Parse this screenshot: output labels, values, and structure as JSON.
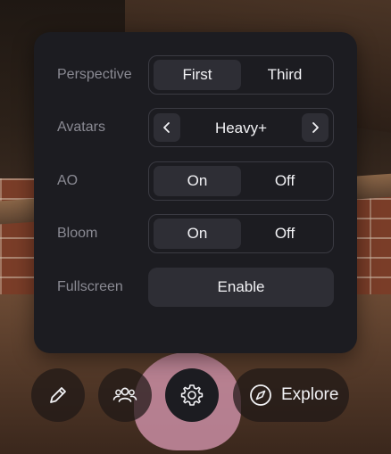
{
  "settings": {
    "perspective": {
      "label": "Perspective",
      "options": [
        "First",
        "Third"
      ],
      "selected": "First"
    },
    "avatars": {
      "label": "Avatars",
      "value": "Heavy+",
      "prev_icon": "chevron-left-icon",
      "next_icon": "chevron-right-icon"
    },
    "ao": {
      "label": "AO",
      "options": [
        "On",
        "Off"
      ],
      "selected": "On"
    },
    "bloom": {
      "label": "Bloom",
      "options": [
        "On",
        "Off"
      ],
      "selected": "On"
    },
    "fullscreen": {
      "label": "Fullscreen",
      "button": "Enable"
    }
  },
  "toolbar": {
    "edit_icon": "pencil-icon",
    "people_icon": "people-icon",
    "settings_icon": "gear-icon",
    "explore_icon": "compass-icon",
    "explore_label": "Explore"
  },
  "colors": {
    "panel_bg": "#1c1c21",
    "selected_bg": "#2e2e35",
    "label": "#8a8a93",
    "text": "#f2f2f5"
  }
}
